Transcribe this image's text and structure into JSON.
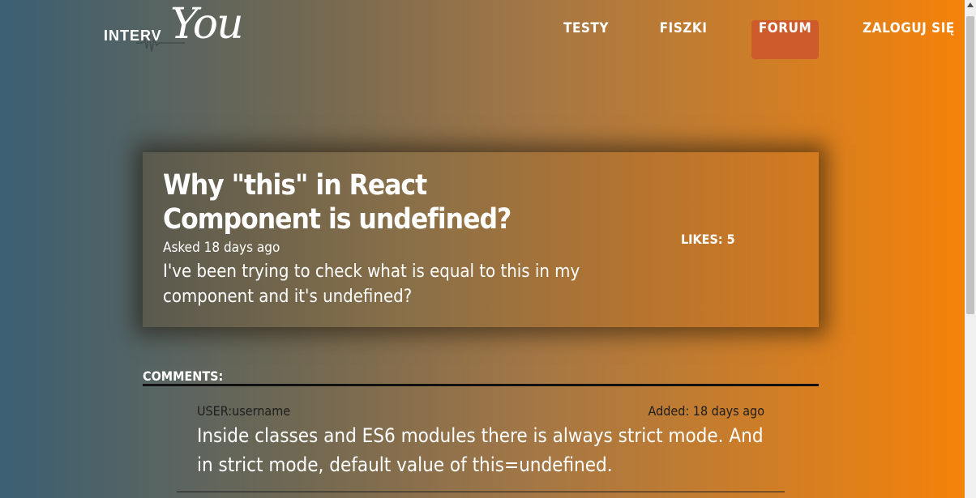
{
  "logo": {
    "small": "INTERV",
    "script": "You"
  },
  "nav": {
    "items": [
      "TESTY",
      "FISZKI",
      "FORUM",
      "ZALOGUJ SIĘ"
    ],
    "active": "FORUM"
  },
  "question": {
    "title": "Why \"this\" in React Component is undefined?",
    "asked": "Asked 18 days ago",
    "body": "I've been trying to check what is equal to this in my component and it's undefined?",
    "likes": "LIKES: 5"
  },
  "comments": {
    "label": "COMMENTS:",
    "items": [
      {
        "user": "USER:username",
        "added": "Added: 18 days ago",
        "text": "Inside classes and ES6 modules there is always strict mode. And in strict mode, default value of this=undefined."
      }
    ]
  },
  "colors": {
    "accent": "#cd5b2c",
    "gradient_start": "#3b5f73",
    "gradient_end": "#f88207"
  },
  "icons": {
    "logo_wave": "soundwave-icon"
  }
}
